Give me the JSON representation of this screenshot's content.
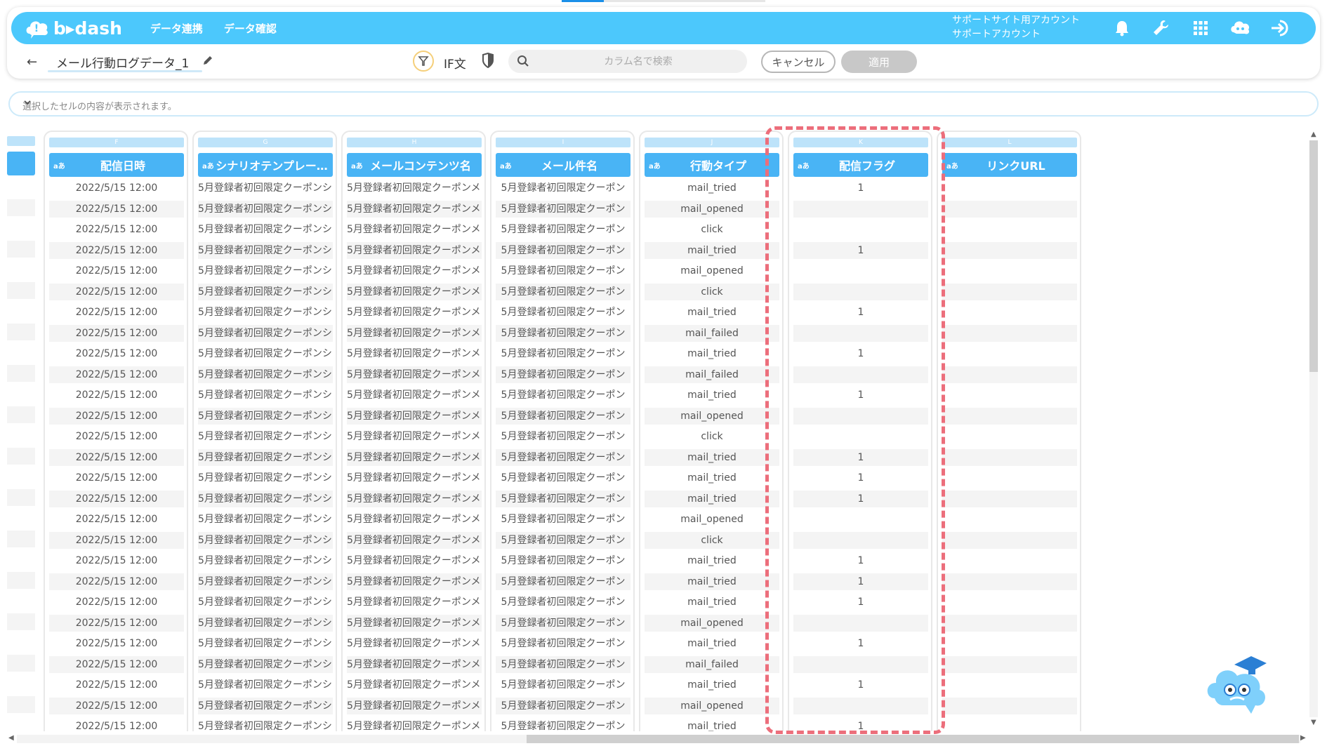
{
  "app": {
    "logo_text": "b▸dash",
    "nav": [
      "データ連携",
      "データ確認"
    ],
    "account_line1": "サポートサイト用アカウント",
    "account_line2": "サポートアカウント",
    "header_icons": [
      "bell-icon",
      "wrench-icon",
      "grid-menu-icon",
      "support-chat-icon",
      "logout-icon"
    ]
  },
  "toolbar": {
    "back": "←",
    "filename": "メール行動ログデータ_1",
    "if_label": "IF文",
    "search_placeholder": "カラム名で検索",
    "cancel_label": "キャンセル",
    "apply_label": "適用"
  },
  "cellbar": {
    "placeholder": "選択したセルの内容が表示されます。"
  },
  "colors": {
    "topbar": "#4cc8fc",
    "header": "#49b4f5",
    "highlight": "#ec6e7b"
  },
  "grid": {
    "type_marker": "aあ",
    "columns": [
      {
        "letter": "F",
        "title": "配信日時"
      },
      {
        "letter": "G",
        "title": "シナリオテンプレー…"
      },
      {
        "letter": "H",
        "title": "メールコンテンツ名"
      },
      {
        "letter": "I",
        "title": "メール件名"
      },
      {
        "letter": "J",
        "title": "行動タイプ"
      },
      {
        "letter": "K",
        "title": "配信フラグ"
      },
      {
        "letter": "L",
        "title": "リンクURL"
      }
    ],
    "rows": [
      [
        "2022/5/15 12:00",
        "5月登録者初回限定クーポンシ...",
        "5月登録者初回限定クーポンメ...",
        "5月登録者初回限定クーポン",
        "mail_tried",
        "1",
        ""
      ],
      [
        "2022/5/15 12:00",
        "5月登録者初回限定クーポンシ...",
        "5月登録者初回限定クーポンメ...",
        "5月登録者初回限定クーポン",
        "mail_opened",
        "",
        ""
      ],
      [
        "2022/5/15 12:00",
        "5月登録者初回限定クーポンシ...",
        "5月登録者初回限定クーポンメ...",
        "5月登録者初回限定クーポン",
        "click",
        "",
        ""
      ],
      [
        "2022/5/15 12:00",
        "5月登録者初回限定クーポンシ...",
        "5月登録者初回限定クーポンメ...",
        "5月登録者初回限定クーポン",
        "mail_tried",
        "1",
        ""
      ],
      [
        "2022/5/15 12:00",
        "5月登録者初回限定クーポンシ...",
        "5月登録者初回限定クーポンメ...",
        "5月登録者初回限定クーポン",
        "mail_opened",
        "",
        ""
      ],
      [
        "2022/5/15 12:00",
        "5月登録者初回限定クーポンシ...",
        "5月登録者初回限定クーポンメ...",
        "5月登録者初回限定クーポン",
        "click",
        "",
        ""
      ],
      [
        "2022/5/15 12:00",
        "5月登録者初回限定クーポンシ...",
        "5月登録者初回限定クーポンメ...",
        "5月登録者初回限定クーポン",
        "mail_tried",
        "1",
        ""
      ],
      [
        "2022/5/15 12:00",
        "5月登録者初回限定クーポンシ...",
        "5月登録者初回限定クーポンメ...",
        "5月登録者初回限定クーポン",
        "mail_failed",
        "",
        ""
      ],
      [
        "2022/5/15 12:00",
        "5月登録者初回限定クーポンシ...",
        "5月登録者初回限定クーポンメ...",
        "5月登録者初回限定クーポン",
        "mail_tried",
        "1",
        ""
      ],
      [
        "2022/5/15 12:00",
        "5月登録者初回限定クーポンシ...",
        "5月登録者初回限定クーポンメ...",
        "5月登録者初回限定クーポン",
        "mail_failed",
        "",
        ""
      ],
      [
        "2022/5/15 12:00",
        "5月登録者初回限定クーポンシ...",
        "5月登録者初回限定クーポンメ...",
        "5月登録者初回限定クーポン",
        "mail_tried",
        "1",
        ""
      ],
      [
        "2022/5/15 12:00",
        "5月登録者初回限定クーポンシ...",
        "5月登録者初回限定クーポンメ...",
        "5月登録者初回限定クーポン",
        "mail_opened",
        "",
        ""
      ],
      [
        "2022/5/15 12:00",
        "5月登録者初回限定クーポンシ...",
        "5月登録者初回限定クーポンメ...",
        "5月登録者初回限定クーポン",
        "click",
        "",
        ""
      ],
      [
        "2022/5/15 12:00",
        "5月登録者初回限定クーポンシ...",
        "5月登録者初回限定クーポンメ...",
        "5月登録者初回限定クーポン",
        "mail_tried",
        "1",
        ""
      ],
      [
        "2022/5/15 12:00",
        "5月登録者初回限定クーポンシ...",
        "5月登録者初回限定クーポンメ...",
        "5月登録者初回限定クーポン",
        "mail_tried",
        "1",
        ""
      ],
      [
        "2022/5/15 12:00",
        "5月登録者初回限定クーポンシ...",
        "5月登録者初回限定クーポンメ...",
        "5月登録者初回限定クーポン",
        "mail_tried",
        "1",
        ""
      ],
      [
        "2022/5/15 12:00",
        "5月登録者初回限定クーポンシ...",
        "5月登録者初回限定クーポンメ...",
        "5月登録者初回限定クーポン",
        "mail_opened",
        "",
        ""
      ],
      [
        "2022/5/15 12:00",
        "5月登録者初回限定クーポンシ...",
        "5月登録者初回限定クーポンメ...",
        "5月登録者初回限定クーポン",
        "click",
        "",
        ""
      ],
      [
        "2022/5/15 12:00",
        "5月登録者初回限定クーポンシ...",
        "5月登録者初回限定クーポンメ...",
        "5月登録者初回限定クーポン",
        "mail_tried",
        "1",
        ""
      ],
      [
        "2022/5/15 12:00",
        "5月登録者初回限定クーポンシ...",
        "5月登録者初回限定クーポンメ...",
        "5月登録者初回限定クーポン",
        "mail_tried",
        "1",
        ""
      ],
      [
        "2022/5/15 12:00",
        "5月登録者初回限定クーポンシ...",
        "5月登録者初回限定クーポンメ...",
        "5月登録者初回限定クーポン",
        "mail_tried",
        "1",
        ""
      ],
      [
        "2022/5/15 12:00",
        "5月登録者初回限定クーポンシ...",
        "5月登録者初回限定クーポンメ...",
        "5月登録者初回限定クーポン",
        "mail_opened",
        "",
        ""
      ],
      [
        "2022/5/15 12:00",
        "5月登録者初回限定クーポンシ...",
        "5月登録者初回限定クーポンメ...",
        "5月登録者初回限定クーポン",
        "mail_tried",
        "1",
        ""
      ],
      [
        "2022/5/15 12:00",
        "5月登録者初回限定クーポンシ...",
        "5月登録者初回限定クーポンメ...",
        "5月登録者初回限定クーポン",
        "mail_failed",
        "",
        ""
      ],
      [
        "2022/5/15 12:00",
        "5月登録者初回限定クーポンシ...",
        "5月登録者初回限定クーポンメ...",
        "5月登録者初回限定クーポン",
        "mail_tried",
        "1",
        ""
      ],
      [
        "2022/5/15 12:00",
        "5月登録者初回限定クーポンシ...",
        "5月登録者初回限定クーポンメ...",
        "5月登録者初回限定クーポン",
        "mail_opened",
        "",
        ""
      ],
      [
        "2022/5/15 12:00",
        "5月登録者初回限定クーポンシ...",
        "5月登録者初回限定クーポンメ...",
        "5月登録者初回限定クーポン",
        "mail_tried",
        "1",
        ""
      ]
    ]
  }
}
